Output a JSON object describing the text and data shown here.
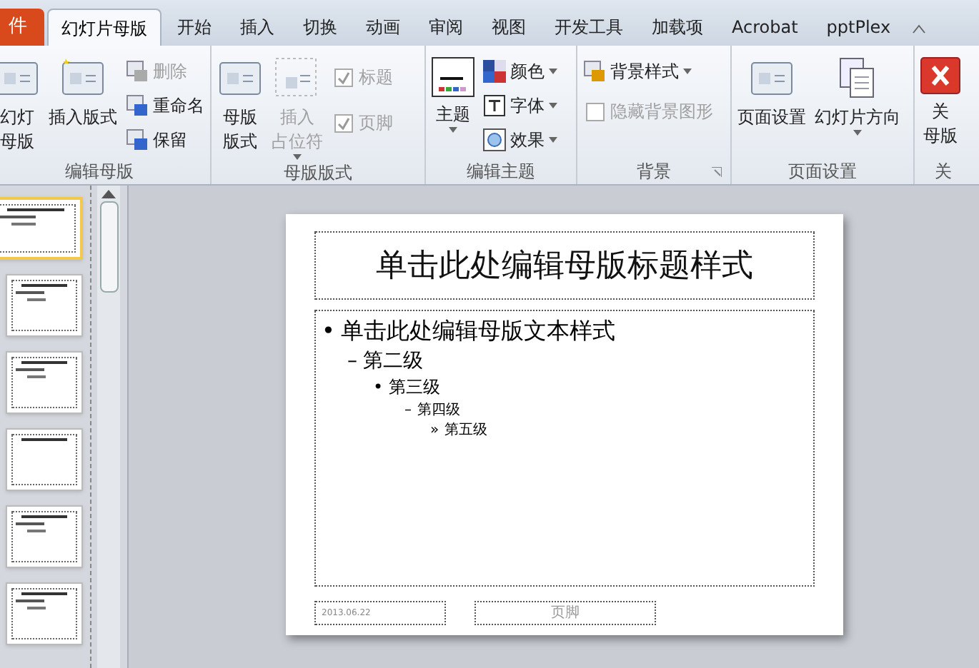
{
  "tabs": [
    {
      "label": "件",
      "kind": "file",
      "selected": false
    },
    {
      "label": "幻灯片母版",
      "kind": "tab",
      "selected": true
    },
    {
      "label": "开始",
      "kind": "tab",
      "selected": false
    },
    {
      "label": "插入",
      "kind": "tab",
      "selected": false
    },
    {
      "label": "切换",
      "kind": "tab",
      "selected": false
    },
    {
      "label": "动画",
      "kind": "tab",
      "selected": false
    },
    {
      "label": "审阅",
      "kind": "tab",
      "selected": false
    },
    {
      "label": "视图",
      "kind": "tab",
      "selected": false
    },
    {
      "label": "开发工具",
      "kind": "tab",
      "selected": false
    },
    {
      "label": "加载项",
      "kind": "tab",
      "selected": false
    },
    {
      "label": "Acrobat",
      "kind": "tab",
      "selected": false
    },
    {
      "label": "pptPlex",
      "kind": "tab",
      "selected": false
    }
  ],
  "ribbon_groups": [
    {
      "label": "编辑母版",
      "columns": [
        [
          {
            "kind": "large",
            "label": [
              "幻灯",
              "母版"
            ],
            "disabled": false,
            "dropdown": false
          }
        ],
        [
          {
            "kind": "large",
            "label": [
              "插入版式"
            ],
            "disabled": false,
            "dropdown": false
          }
        ],
        [
          {
            "kind": "small",
            "label": "删除",
            "disabled": true,
            "dropdown": false
          },
          {
            "kind": "small",
            "label": "重命名",
            "disabled": false,
            "dropdown": false
          },
          {
            "kind": "small",
            "label": "保留",
            "disabled": false,
            "dropdown": false
          }
        ]
      ]
    },
    {
      "label": "母版版式",
      "columns": [
        [
          {
            "kind": "large",
            "label": [
              "母版",
              "版式"
            ],
            "disabled": false,
            "dropdown": false
          }
        ],
        [
          {
            "kind": "large",
            "label": [
              "插入",
              "占位符"
            ],
            "disabled": true,
            "dropdown": true
          }
        ],
        [
          {
            "kind": "check",
            "label": "标题",
            "disabled": true,
            "checked": true
          },
          {
            "kind": "check",
            "label": "页脚",
            "disabled": true,
            "checked": true
          }
        ]
      ]
    },
    {
      "label": "编辑主题",
      "columns": [
        [
          {
            "kind": "large",
            "label": [
              "主题"
            ],
            "disabled": false,
            "dropdown": true
          }
        ],
        [
          {
            "kind": "small",
            "label": "颜色",
            "disabled": false,
            "dropdown": true
          },
          {
            "kind": "small",
            "label": "字体",
            "disabled": false,
            "dropdown": true
          },
          {
            "kind": "small",
            "label": "效果",
            "disabled": false,
            "dropdown": true
          }
        ]
      ]
    },
    {
      "label": "背景",
      "columns": [
        [
          {
            "kind": "small",
            "label": "背景样式",
            "disabled": false,
            "dropdown": true
          },
          {
            "kind": "check",
            "label": "隐藏背景图形",
            "disabled": true,
            "checked": false
          }
        ]
      ]
    },
    {
      "label": "页面设置",
      "columns": [
        [
          {
            "kind": "large",
            "label": [
              "页面设置"
            ],
            "disabled": false,
            "dropdown": false
          }
        ],
        [
          {
            "kind": "large",
            "label": [
              "幻灯片方向"
            ],
            "disabled": false,
            "dropdown": true
          }
        ]
      ]
    },
    {
      "label": "关",
      "columns": [
        [
          {
            "kind": "large",
            "label": [
              "关",
              "母版"
            ],
            "disabled": false,
            "dropdown": false
          }
        ]
      ]
    }
  ],
  "thumbnails": [
    {
      "selected": true
    },
    {
      "selected": false
    },
    {
      "selected": false
    },
    {
      "selected": false
    },
    {
      "selected": false
    },
    {
      "selected": false
    }
  ],
  "slide": {
    "title": "单击此处编辑母版标题样式",
    "levels": [
      {
        "bullet": "•",
        "text": "单击此处编辑母版文本样式"
      },
      {
        "bullet": "–",
        "text": "第二级"
      },
      {
        "bullet": "•",
        "text": "第三级"
      },
      {
        "bullet": "–",
        "text": "第四级"
      },
      {
        "bullet": "»",
        "text": "第五级"
      }
    ],
    "date": "2013.06.22",
    "footer": "页脚"
  }
}
